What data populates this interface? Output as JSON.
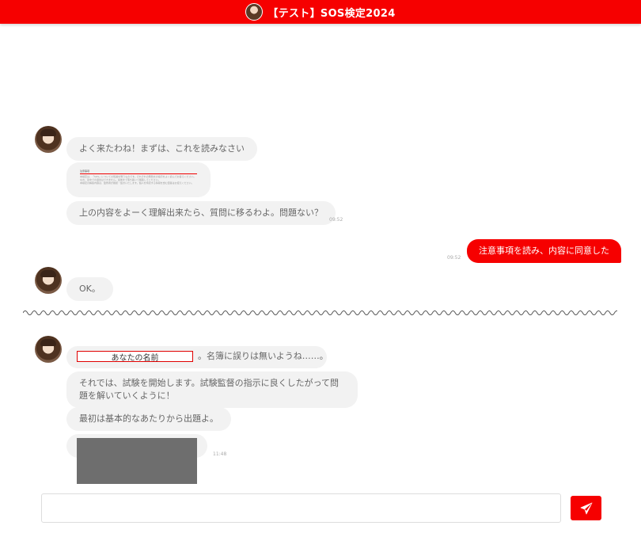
{
  "header": {
    "title": "【テスト】SOS検定2024",
    "avatar_icon": "character-avatar-icon",
    "color": "#f60000"
  },
  "messages": {
    "m1": {
      "text": "よく来たわね！まずは、これを読みなさい"
    },
    "doc": {
      "title": "注意事項",
      "lines": [
        "本検定は、「SOS」についての知識を問うものです。それぞれの問題文の指示をよく読んでお答えください。",
        "なお、途中での退出はできません。最後まで落ち着いて解答してください。",
        "本検定の解答内容は、監修者が確認・集計いたします。個人を特定する情報を含む回答はお控えください。"
      ]
    },
    "m2": {
      "text": "上の内容をよーく理解出来たら、質問に移るわよ。問題ない？",
      "time": "09:52"
    },
    "user": {
      "text": "注意事項を読み、内容に同意した",
      "time": "09:52"
    },
    "m3": {
      "text": "OK。"
    },
    "m4": {
      "name_field": "あなたの名前",
      "suffix": "。名簿に誤りは無いようね……。"
    },
    "m5": {
      "text": "それでは、試験を開始します。試験監督の指示に良くしたがって問題を解いていくように！"
    },
    "m6": {
      "text": "最初は基本的なあたりから出題よ。"
    },
    "m7": {
      "time": "11:48"
    }
  },
  "composer": {
    "value": "",
    "placeholder": "",
    "send_icon": "paper-plane-icon"
  },
  "colors": {
    "accent": "#f60000",
    "bot_bubble": "#f2f2f2"
  }
}
